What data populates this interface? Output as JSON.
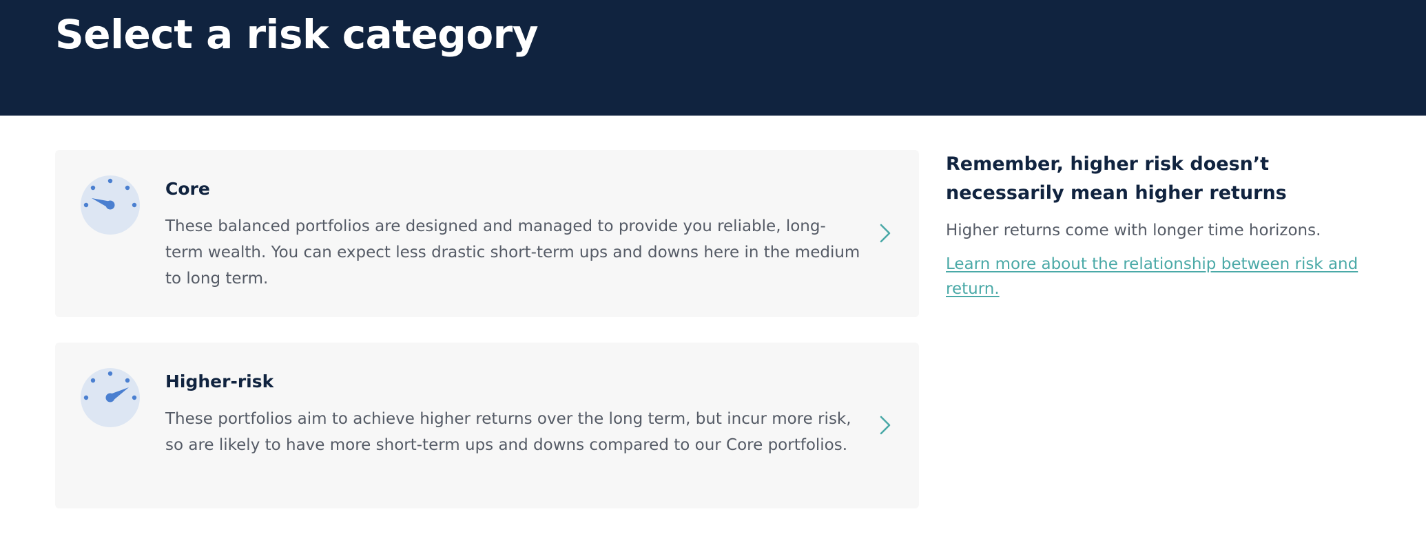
{
  "header": {
    "title": "Select a risk category"
  },
  "categories": [
    {
      "title": "Core",
      "description": "These balanced portfolios are designed and managed to provide you reliable, long-term wealth. You can expect less drastic short-term ups and downs here in the medium to long term.",
      "icon": "dial-low-risk-icon"
    },
    {
      "title": "Higher-risk",
      "description": "These portfolios aim to achieve higher returns over the long term, but incur more risk, so are likely to have more short-term ups and downs compared to our Core portfolios.",
      "icon": "dial-high-risk-icon"
    }
  ],
  "sidebar": {
    "heading": "Remember, higher risk doesn’t necessarily mean higher returns",
    "text": "Higher returns come with longer time horizons.",
    "link": "Learn more about the relationship between risk and return."
  },
  "colors": {
    "header_bg": "#10233f",
    "card_bg": "#f7f7f7",
    "dial_face": "#dde6f3",
    "dial_accent": "#4a7fd0",
    "chevron": "#4aa9a7",
    "link": "#4aa9a7",
    "heading_text": "#10233f",
    "body_text": "#555b66"
  }
}
